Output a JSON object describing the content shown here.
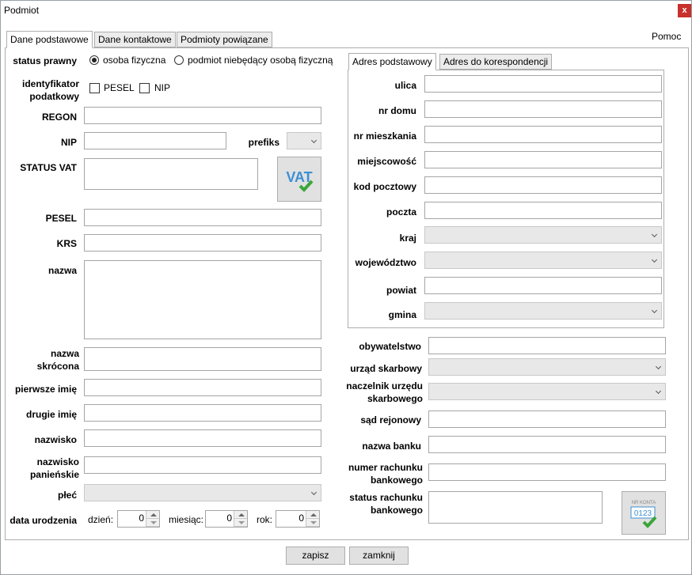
{
  "window": {
    "title": "Podmiot",
    "close": "x",
    "help": "Pomoc"
  },
  "tabs": [
    "Dane podstawowe",
    "Dane kontaktowe",
    "Podmioty powiązane"
  ],
  "left": {
    "status_prawny": "status prawny",
    "radio1": "osoba fizyczna",
    "radio2": "podmiot niebędący osobą fizyczną",
    "identyfikator": "identyfikator podatkowy",
    "chk_pesel": "PESEL",
    "chk_nip": "NIP",
    "regon": "REGON",
    "nip": "NIP",
    "prefiks": "prefiks",
    "status_vat": "STATUS VAT",
    "vat_icon_text": "VAT",
    "pesel": "PESEL",
    "krs": "KRS",
    "nazwa": "nazwa",
    "nazwa_skrocona": "nazwa skrócona",
    "pierwsze_imie": "pierwsze imię",
    "drugie_imie": "drugie imię",
    "nazwisko": "nazwisko",
    "nazwisko_panienskie": "nazwisko panieńskie",
    "plec": "płeć",
    "data_urodzenia": "data urodzenia",
    "dzien": "dzień:",
    "miesiac": "miesiąc:",
    "rok": "rok:",
    "dzien_val": "0",
    "miesiac_val": "0",
    "rok_val": "0"
  },
  "address_tabs": [
    "Adres podstawowy",
    "Adres do korespondencji"
  ],
  "address": {
    "ulica": "ulica",
    "nr_domu": "nr domu",
    "nr_mieszkania": "nr mieszkania",
    "miejscowosc": "miejscowość",
    "kod_pocztowy": "kod pocztowy",
    "poczta": "poczta",
    "kraj": "kraj",
    "wojewodztwo": "województwo",
    "powiat": "powiat",
    "gmina": "gmina"
  },
  "right": {
    "obywatelstwo": "obywatelstwo",
    "urzad_skarbowy": "urząd skarbowy",
    "naczelnik": "naczelnik urzędu skarbowego",
    "sad_rejonowy": "sąd rejonowy",
    "nazwa_banku": "nazwa banku",
    "numer_rachunku": "numer rachunku bankowego",
    "status_rachunku": "status rachunku bankowego",
    "nr_konta_icon_label": "NR KONTA",
    "nr_konta_icon_digits": "0123"
  },
  "buttons": {
    "save": "zapisz",
    "close": "zamknij"
  },
  "colors": {
    "close_red": "#c7302b",
    "vat_blue": "#3d8fd4",
    "check_green": "#3aa63a"
  }
}
